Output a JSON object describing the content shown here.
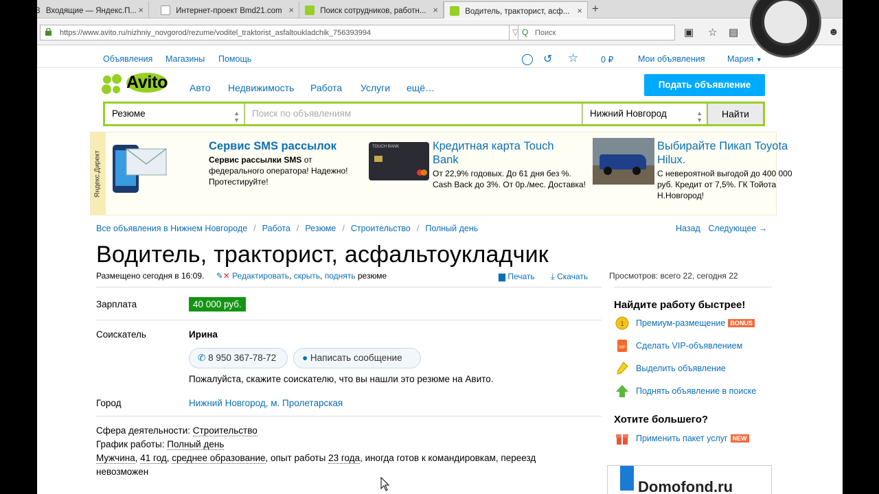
{
  "browser": {
    "tabs": [
      {
        "label": "Входящие — Яндекс.П...",
        "close": "×"
      },
      {
        "label": "Интернет-проект Bmd21.com",
        "close": "×"
      },
      {
        "label": "Поиск сотрудников, работн...",
        "close": "×"
      },
      {
        "label": "Водитель, тракторист, асф...",
        "close": "×"
      }
    ],
    "first_tab_fragment": "3",
    "newtab": "+",
    "url": "https://www.avito.ru/nizhniy_novgorod/rezume/voditel_traktorist_asfaltoukladchik_756393994",
    "search_placeholder": "Поиск"
  },
  "topmenu": {
    "ads": "Объявления",
    "shops": "Магазины",
    "help": "Помощь",
    "balance": "0 ₽",
    "my_ads": "Мои объявления",
    "user": "Мария"
  },
  "header": {
    "logo": "Avito",
    "nav": [
      "Авто",
      "Недвижимость",
      "Работа",
      "Услуги",
      "ещё…"
    ],
    "post_button": "Подать объявление"
  },
  "search": {
    "category": "Резюме",
    "placeholder": "Поиск по объявлениям",
    "city": "Нижний Новгород",
    "button": "Найти"
  },
  "ads": {
    "label": "Яндекс.Директ",
    "items": [
      {
        "title": "Сервис SMS рассылок",
        "text_bold1": "Сервис рассылки SMS",
        "text_rest": " от федерального оператора! Надежно! Протестируйте!"
      },
      {
        "title": "Кредитная карта Touch Bank",
        "text": "От 22,9% годовых. До 61 дня без %. Cash Back до 3%. От 0р./мес. Доставка!",
        "card_brand": "TOUCH BANK"
      },
      {
        "title": "Выбирайте Пикап Toyota Hilux.",
        "text": "С невероятной выгодой до 400 000 руб. Кредит от 7,5%. ГК Тойота Н.Новгород!"
      }
    ]
  },
  "breadcrumbs": [
    "Все объявления в Нижнем Новгороде",
    "Работа",
    "Резюме",
    "Строительство",
    "Полный день"
  ],
  "breadcrumb_sep": "/",
  "pager": {
    "back": "Назад",
    "next": "Следующее →"
  },
  "resume": {
    "title": "Водитель, тракторист, асфальтоукладчик",
    "posted": "Размещено сегодня в 16:09.",
    "edit": "Редактировать",
    "hide": "скрыть",
    "raise": "поднять",
    "resume_word": "резюме",
    "print": "Печать",
    "download": "Скачать",
    "views": "Просмотров: всего 22, сегодня 22",
    "salary_label": "Зарплата",
    "salary": "40 000 руб.",
    "seeker_label": "Соискатель",
    "seeker": "Ирина",
    "phone": "8 950 367-78-72",
    "message": "Написать сообщение",
    "note": "Пожалуйста, скажите соискателю, что вы нашли это резюме на Авито.",
    "city_label": "Город",
    "city": "Нижний Новгород, м. Пролетарская",
    "sphere_label": "Сфера деятельности: ",
    "sphere": "Строительство",
    "schedule_label": "График работы: ",
    "schedule": "Полный день",
    "gender": "Мужчина",
    "age": "41 год",
    "education": "среднее образование",
    "exp_prefix": ", опыт работы ",
    "experience": "23 года",
    "rest_line1": ", иногда готов к командировкам, переезд",
    "rest_line2": "невозможен"
  },
  "sidebar": {
    "heading1": "Найдите работу быстрее!",
    "items1": [
      {
        "label": "Премиум-размещение",
        "badge": "BONUS"
      },
      {
        "label": "Сделать VIP-объявлением"
      },
      {
        "label": "Выделить объявление"
      },
      {
        "label": "Поднять объявление в поиске"
      }
    ],
    "heading2": "Хотите большего?",
    "package": {
      "label": "Применить пакет услуг",
      "badge": "NEW"
    },
    "banner": "Domofond.ru"
  },
  "colors": {
    "link": "#0b6fb7",
    "brand_green": "#97cf26",
    "post_button": "#00aaff",
    "salary_bg": "#149414"
  }
}
